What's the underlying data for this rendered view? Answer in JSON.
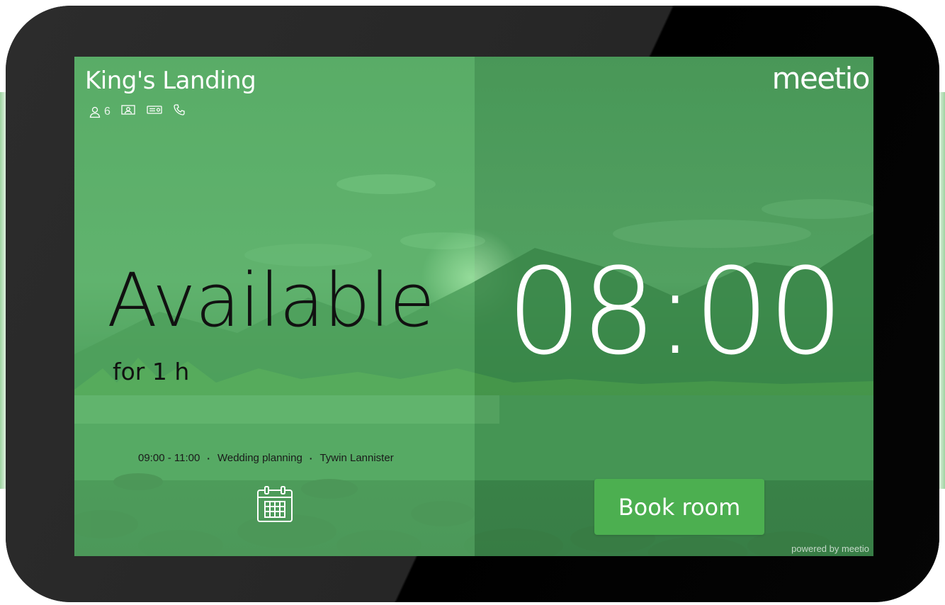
{
  "room": {
    "name": "King's Landing",
    "capacity": "6",
    "amenities": [
      "person-icon",
      "video-conference-icon",
      "projector-icon",
      "phone-icon"
    ]
  },
  "brand": {
    "logo_text": "meetio",
    "powered_by": "powered by meetio"
  },
  "status": {
    "label": "Available",
    "duration": "for 1 h"
  },
  "clock": {
    "time": "08:00"
  },
  "next_meeting": {
    "time": "09:00 - 11:00",
    "title": "Wedding planning",
    "organizer": "Tywin Lannister"
  },
  "actions": {
    "book_label": "Book room",
    "calendar_icon": "calendar-icon"
  },
  "colors": {
    "accent": "#4caf50",
    "bezel": "#262626"
  }
}
